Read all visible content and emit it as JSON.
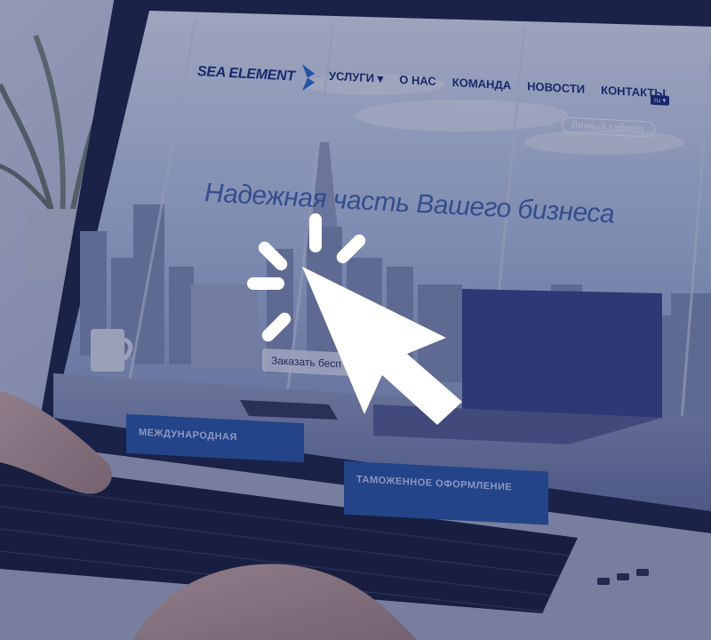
{
  "website": {
    "brand": "SEA ELEMENT",
    "nav": [
      "УСЛУГИ ▾",
      "О НАС",
      "КОМАНДА",
      "НОВОСТИ",
      "КОНТАКТЫ"
    ],
    "lang": "ru ▾",
    "account_button": "Личный кабинет",
    "hero_title": "Надежная часть Вашего бизнеса",
    "order_button": "Заказать бесп",
    "tiles": [
      "МЕЖДУНАРОДНАЯ",
      "ТАМОЖЕННОЕ ОФОРМЛЕНИЕ"
    ]
  },
  "colors": {
    "overlay": "#2b3566",
    "brand": "#1d2f7c",
    "accent": "#2c5aa6",
    "cursor": "#ffffff"
  },
  "icons": [
    "cursor-click-icon",
    "brand-logo-icon"
  ]
}
